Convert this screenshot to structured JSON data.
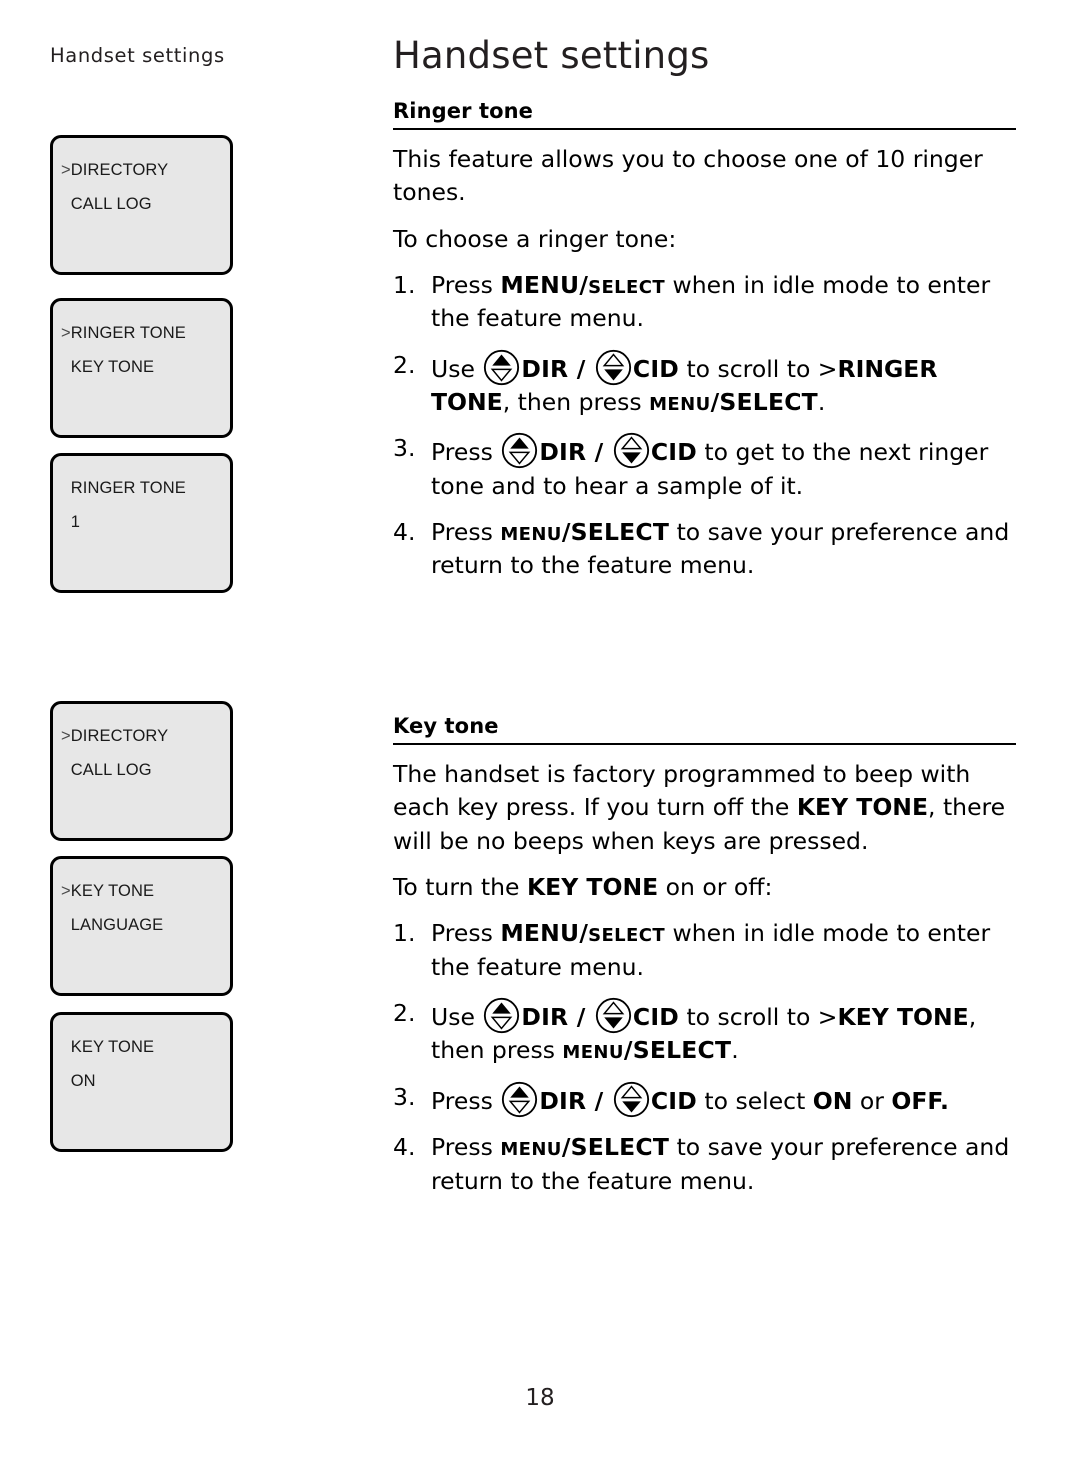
{
  "running_header": "Handset settings",
  "page_title": "Handset settings",
  "page_number": "18",
  "colors": {
    "lcd_fill": "#e7e7e7",
    "lcd_border": "#000000",
    "text": "#231f20"
  },
  "lcd_screens": [
    {
      "name": "menu-directory-1",
      "line1_arrow": ">",
      "line1": "DIRECTORY",
      "line2": "CALL LOG"
    },
    {
      "name": "menu-ringer-tone",
      "line1_arrow": ">",
      "line1": "RINGER TONE",
      "line2": "KEY TONE"
    },
    {
      "name": "ringer-tone-value",
      "line1_arrow": "",
      "line1": "RINGER TONE",
      "line2": "1"
    },
    {
      "name": "menu-directory-2",
      "line1_arrow": ">",
      "line1": "DIRECTORY",
      "line2": "CALL LOG"
    },
    {
      "name": "menu-key-tone",
      "line1_arrow": ">",
      "line1": "KEY TONE",
      "line2": "LANGUAGE"
    },
    {
      "name": "key-tone-value",
      "line1_arrow": "",
      "line1": "KEY TONE",
      "line2": "ON"
    }
  ],
  "sections": {
    "ringer_tone": {
      "heading": "Ringer tone",
      "paragraph1": "This feature allows you to choose one of 10 ringer tones.",
      "paragraph2": "To choose a ringer tone:",
      "steps": [
        {
          "num": "1.",
          "pre": "Press ",
          "key_big": "MENU",
          "key_sep": "/",
          "key_small": "SELECT",
          "post": " when in idle mode to enter the feature menu."
        },
        {
          "num": "2.",
          "pre": "Use ",
          "dir_label": "DIR",
          "sep": " / ",
          "cid_label": "CID",
          "mid": " to scroll to >",
          "target": "RINGER TONE",
          "after": ", then press ",
          "key_small": "MENU",
          "key_sep": "/",
          "key_big": "SELECT",
          "end": "."
        },
        {
          "num": "3.",
          "pre": "Press ",
          "dir_label": "DIR",
          "sep": " / ",
          "cid_label": "CID",
          "post": " to get to the next ringer tone and to hear a sample of it."
        },
        {
          "num": "4.",
          "pre": "Press ",
          "key_small": "MENU",
          "key_sep": "/",
          "key_big": "SELECT",
          "post": " to save your preference and return to the feature menu."
        }
      ]
    },
    "key_tone": {
      "heading": "Key tone",
      "paragraph1_a": "The handset is factory programmed to beep with each key press. If you turn off the ",
      "paragraph1_bold": "KEY TONE",
      "paragraph1_b": ", there will be no beeps when keys are pressed.",
      "paragraph2_a": "To turn the ",
      "paragraph2_bold": "KEY TONE",
      "paragraph2_b": " on or off:",
      "steps": [
        {
          "num": "1.",
          "pre": "Press ",
          "key_big": "MENU",
          "key_sep": "/",
          "key_small": "SELECT",
          "post": " when in idle mode to enter the feature menu."
        },
        {
          "num": "2.",
          "pre": "Use ",
          "dir_label": "DIR",
          "sep": " / ",
          "cid_label": "CID",
          "mid": " to scroll to >",
          "target": "KEY TONE",
          "after": ", then press ",
          "key_small": "MENU",
          "key_sep": "/",
          "key_big": "SELECT",
          "end": "."
        },
        {
          "num": "3.",
          "pre": "Press ",
          "dir_label": "DIR",
          "sep": " / ",
          "cid_label": "CID",
          "mid": " to select ",
          "on_label": "ON",
          "or_label": " or ",
          "off_label": "OFF",
          "end": "."
        },
        {
          "num": "4.",
          "pre": "Press ",
          "key_small": "MENU",
          "key_sep": "/",
          "key_big": "SELECT",
          "post": " to save your preference and return to the feature menu."
        }
      ]
    }
  },
  "icons": {
    "dir_key": "nav-up-key-icon",
    "cid_key": "nav-down-key-icon"
  }
}
